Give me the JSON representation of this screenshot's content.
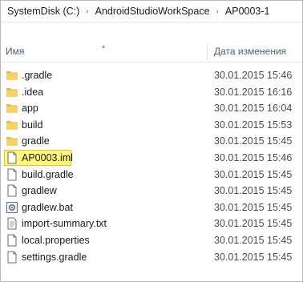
{
  "breadcrumb": {
    "items": [
      "SystemDisk (C:)",
      "AndroidStudioWorkSpace",
      "AP0003-1"
    ],
    "separator": "›"
  },
  "columns": {
    "name": "Имя",
    "date": "Дата изменения"
  },
  "colors": {
    "folder": "#f2c94c",
    "header_text": "#4c607a",
    "highlight": "#fff77a"
  },
  "files": [
    {
      "name": ".gradle",
      "date": "30.01.2015 15:46",
      "icon": "folder-icon"
    },
    {
      "name": ".idea",
      "date": "30.01.2015 16:16",
      "icon": "folder-icon"
    },
    {
      "name": "app",
      "date": "30.01.2015 16:04",
      "icon": "folder-icon"
    },
    {
      "name": "build",
      "date": "30.01.2015 15:53",
      "icon": "folder-icon"
    },
    {
      "name": "gradle",
      "date": "30.01.2015 15:45",
      "icon": "folder-icon"
    },
    {
      "name": "AP0003.iml",
      "date": "30.01.2015 15:46",
      "icon": "file-icon",
      "highlighted": true
    },
    {
      "name": "build.gradle",
      "date": "30.01.2015 15:45",
      "icon": "file-icon"
    },
    {
      "name": "gradlew",
      "date": "30.01.2015 15:45",
      "icon": "file-icon"
    },
    {
      "name": "gradlew.bat",
      "date": "30.01.2015 15:45",
      "icon": "batch-file-icon"
    },
    {
      "name": "import-summary.txt",
      "date": "30.01.2015 15:45",
      "icon": "text-file-icon"
    },
    {
      "name": "local.properties",
      "date": "30.01.2015 15:45",
      "icon": "file-icon"
    },
    {
      "name": "settings.gradle",
      "date": "30.01.2015 15:45",
      "icon": "file-icon"
    }
  ]
}
